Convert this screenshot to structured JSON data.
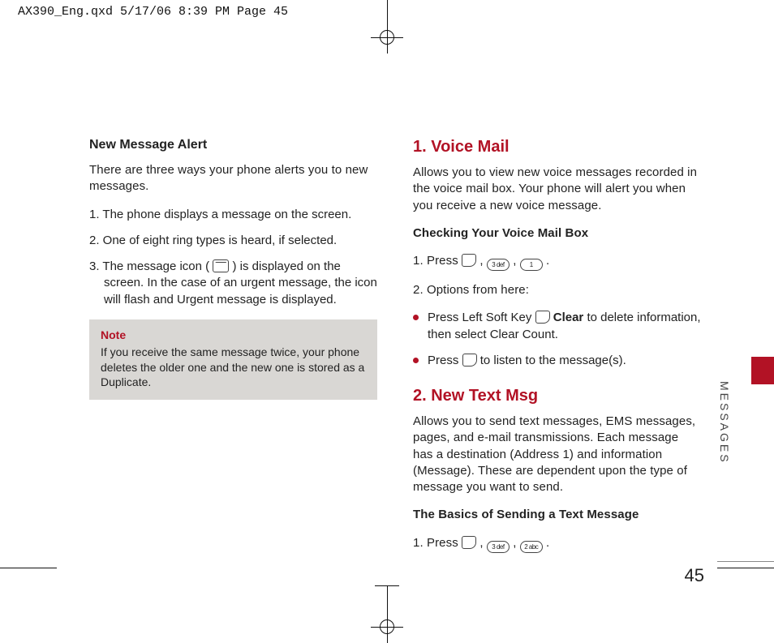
{
  "crop_header": "AX390_Eng.qxd  5/17/06  8:39 PM  Page 45",
  "left": {
    "h1": "New Message Alert",
    "p1": "There are three ways your phone alerts you to new messages.",
    "li1": "1. The phone displays a message on the screen.",
    "li2": "2. One of eight ring types is heard, if selected.",
    "li3a": "3. The message icon (",
    "li3b": ") is displayed on the screen. In the case of an urgent message, the icon will flash and Urgent message is displayed.",
    "note_title": "Note",
    "note_body": "If you receive the same message twice, your phone deletes the older one and the new one is stored as a Duplicate."
  },
  "right": {
    "h1": "1. Voice Mail",
    "p1": "Allows you to view new voice messages recorded in the voice mail box. Your phone will alert you when you receive a new voice message.",
    "h1sub": "Checking Your Voice Mail Box",
    "press1_a": "1. Press ",
    "press1_b": ", ",
    "press1_c": ", ",
    "press1_d": " .",
    "opt1": "2. Options from here:",
    "b1a": "Press Left Soft Key ",
    "b1b": " ",
    "b1c": "Clear",
    "b1d": " to delete information, then select Clear Count.",
    "b2a": "Press ",
    "b2b": " to listen to the message(s).",
    "h2": "2. New Text Msg",
    "p2": "Allows you to send text messages, EMS messages, pages, and e-mail transmissions. Each message has a destination (Address 1) and information (Message). These are dependent upon the type of message you want to send.",
    "h2sub": "The Basics of Sending a Text Message",
    "press2_a": "1. Press ",
    "press2_b": ", ",
    "press2_c": ", ",
    "press2_d": " .",
    "key3": "3 def",
    "key1": "1",
    "key2": "2 abc"
  },
  "side_label": "MESSAGES",
  "page_number": "45"
}
